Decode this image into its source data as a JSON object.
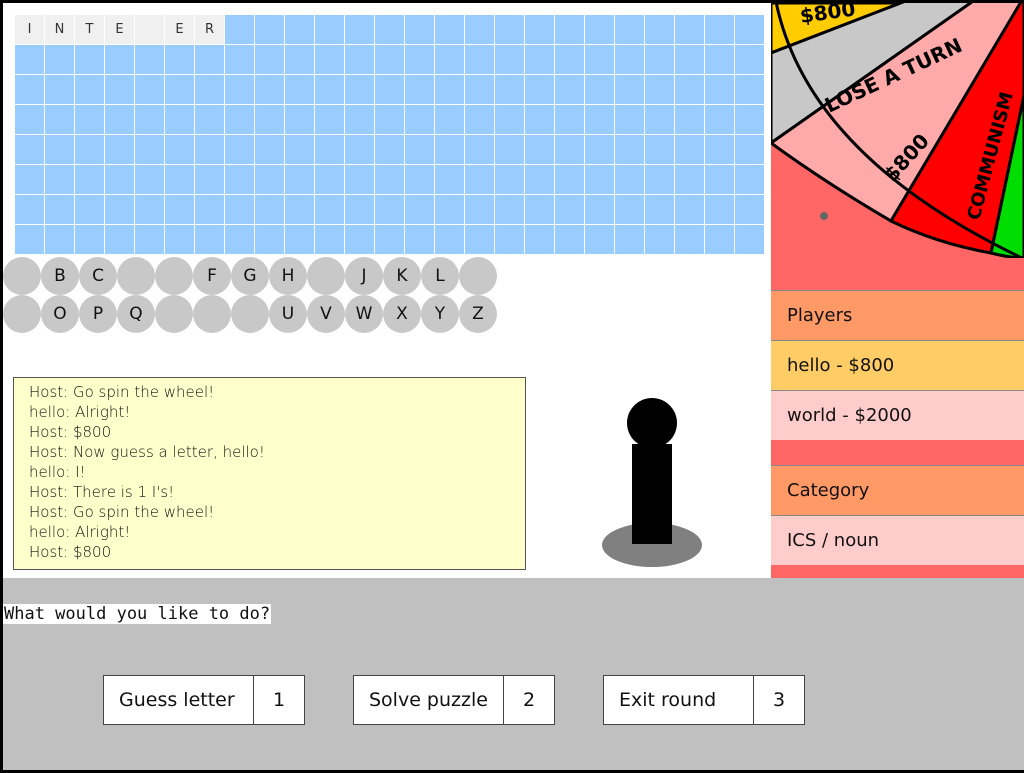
{
  "puzzle": {
    "cols": 25,
    "rows": 8,
    "revealed_row": [
      {
        "letter": "I",
        "open": true
      },
      {
        "letter": "N",
        "open": true
      },
      {
        "letter": "T",
        "open": true
      },
      {
        "letter": "E",
        "open": true
      },
      {
        "letter": "",
        "open": true
      },
      {
        "letter": "E",
        "open": true
      },
      {
        "letter": "R",
        "open": true
      }
    ]
  },
  "letters": {
    "row1": [
      "",
      "B",
      "C",
      "",
      "",
      "F",
      "G",
      "H",
      "",
      "J",
      "K",
      "L",
      ""
    ],
    "row2": [
      "",
      "O",
      "P",
      "Q",
      "",
      "",
      "",
      "U",
      "V",
      "W",
      "X",
      "Y",
      "Z"
    ]
  },
  "chat": [
    "Host: Go spin the wheel!",
    "hello: Alright!",
    "Host: $800",
    "Host: Now guess a letter, hello!",
    "hello: I!",
    "Host: There is 1 I's!",
    "Host: Go spin the wheel!",
    "hello: Alright!",
    "Host: $800"
  ],
  "wheel": {
    "segments": [
      {
        "label": "$800",
        "color": "#ffcc00"
      },
      {
        "label": "LOSE A TURN",
        "color": "#c0c0c0"
      },
      {
        "label": "$800",
        "color": "#ffaaaa"
      },
      {
        "label": "COMMUNISM",
        "color": "#ff0000"
      },
      {
        "label": "",
        "color": "#00dd00"
      }
    ]
  },
  "players": {
    "heading": "Players",
    "list": [
      {
        "text": "hello - $800"
      },
      {
        "text": "world - $2000"
      }
    ]
  },
  "category": {
    "heading": "Category",
    "value": "ICS / noun"
  },
  "prompt": "What would you like to do?",
  "options": [
    {
      "label": "Guess letter",
      "key": "1"
    },
    {
      "label": "Solve puzzle",
      "key": "2"
    },
    {
      "label": "Exit round",
      "key": "3"
    }
  ],
  "colors": {
    "board_blank": "#99ccff",
    "board_open": "#f0f0f0",
    "chat_bg": "#ffffcc",
    "side_bg": "#ff6666"
  }
}
